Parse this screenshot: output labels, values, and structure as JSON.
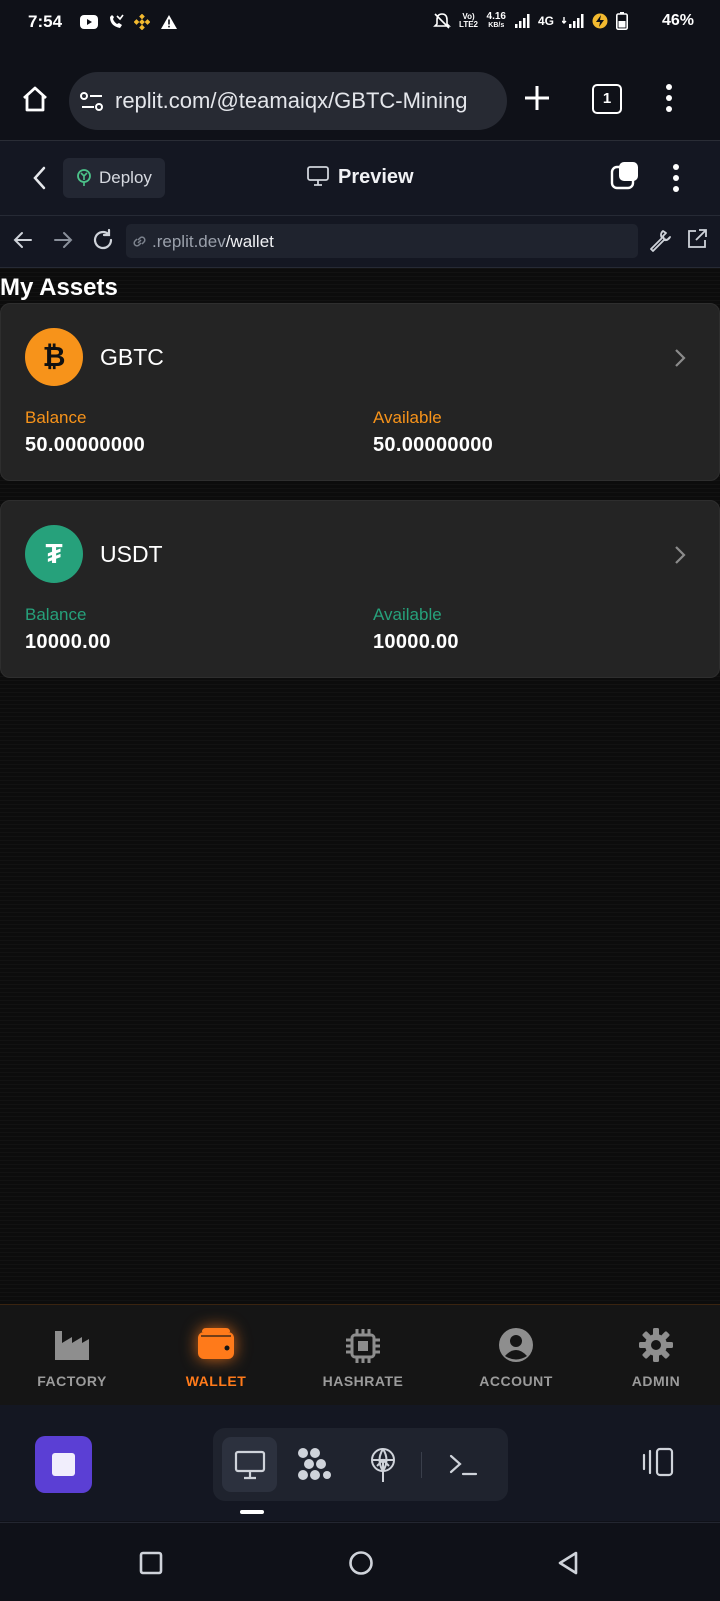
{
  "status_bar": {
    "time": "7:54",
    "battery": "46%",
    "network": "4G",
    "net_speed": "4.16",
    "net_speed_unit": "KB/s",
    "volte": "Vo) LTE2"
  },
  "browser": {
    "url": "replit.com/@teamaiqx/GBTC-Mining",
    "tab_count": "1"
  },
  "replit": {
    "deploy_label": "Deploy",
    "preview_label": "Preview"
  },
  "webview": {
    "url_domain": ".replit.dev",
    "url_path": "/wallet"
  },
  "page": {
    "title": "My Assets"
  },
  "assets": [
    {
      "symbol": "GBTC",
      "icon": "bitcoin-icon",
      "icon_glyph": "₿",
      "color": "#f7931a",
      "balance_label": "Balance",
      "balance": "50.00000000",
      "available_label": "Available",
      "available": "50.00000000"
    },
    {
      "symbol": "USDT",
      "icon": "tether-icon",
      "icon_glyph": "₮",
      "color": "#26a17b",
      "balance_label": "Balance",
      "balance": "10000.00",
      "available_label": "Available",
      "available": "10000.00"
    }
  ],
  "tabs": [
    {
      "label": "FACTORY",
      "icon": "factory-icon",
      "active": false
    },
    {
      "label": "WALLET",
      "icon": "wallet-icon",
      "active": true
    },
    {
      "label": "HASHRATE",
      "icon": "cpu-chip-icon",
      "active": false
    },
    {
      "label": "ACCOUNT",
      "icon": "user-circle-icon",
      "active": false
    },
    {
      "label": "ADMIN",
      "icon": "gear-icon",
      "active": false
    }
  ],
  "colors": {
    "accent": "#ff7a1a",
    "gbtc": "#f7931a",
    "usdt": "#26a17b",
    "tab_inactive": "#9b9b9b",
    "stop_button": "#5b3fd4"
  }
}
